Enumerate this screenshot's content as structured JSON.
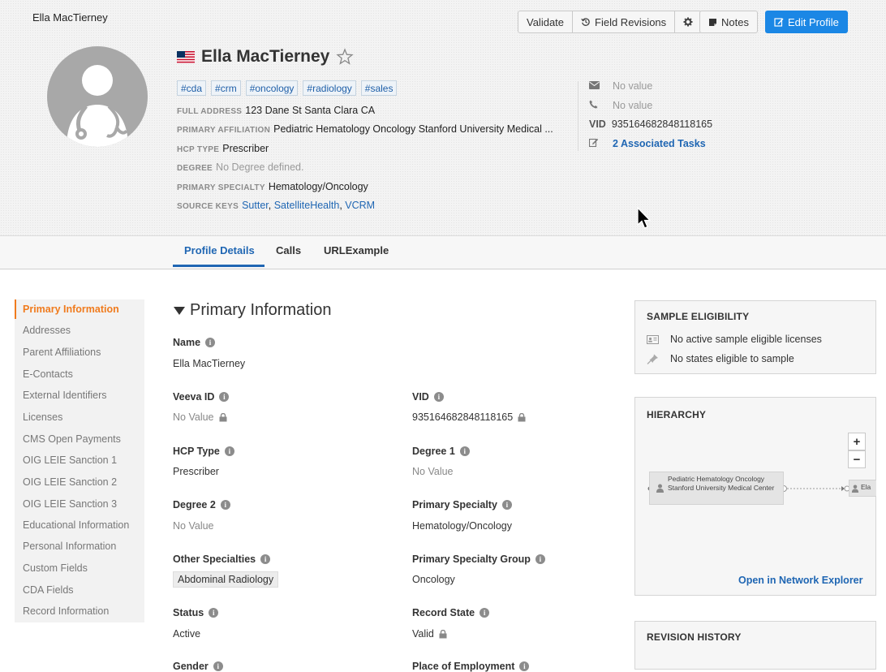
{
  "window": {
    "title": "Ella MacTierney"
  },
  "toolbar": {
    "validate_label": "Validate",
    "field_revisions_label": "Field Revisions",
    "notes_label": "Notes",
    "edit_profile_label": "Edit Profile",
    "accent_color": "#1b87e5"
  },
  "profile": {
    "name": "Ella MacTierney",
    "tags": [
      "#cda",
      "#crm",
      "#oncology",
      "#radiology",
      "#sales"
    ],
    "full_address_label": "FULL ADDRESS",
    "full_address": "123 Dane St Santa Clara CA",
    "primary_affiliation_label": "PRIMARY AFFILIATION",
    "primary_affiliation": "Pediatric Hematology Oncology Stanford University Medical ...",
    "hcp_type_label": "HCP TYPE",
    "hcp_type": "Prescriber",
    "degree_label": "DEGREE",
    "degree": "No Degree defined.",
    "primary_specialty_label": "PRIMARY SPECIALTY",
    "primary_specialty": "Hematology/Oncology",
    "source_keys_label": "SOURCE KEYS",
    "source_keys": [
      "Sutter",
      "SatelliteHealth",
      "VCRM"
    ],
    "source_keys_sep": ", "
  },
  "contact": {
    "email": "No value",
    "phone": "No value",
    "vid_label": "VID",
    "vid": "935164682848118165",
    "tasks": "2 Associated Tasks"
  },
  "tabs": [
    "Profile Details",
    "Calls",
    "URLExample"
  ],
  "nav": {
    "items": [
      "Primary Information",
      "Addresses",
      "Parent Affiliations",
      "E-Contacts",
      "External Identifiers",
      "Licenses",
      "CMS Open Payments",
      "OIG LEIE Sanction 1",
      "OIG LEIE Sanction 2",
      "OIG LEIE Sanction 3",
      "Educational Information",
      "Personal Information",
      "Custom Fields",
      "CDA Fields",
      "Record Information"
    ],
    "active_color": "#f07b1d"
  },
  "primary_info": {
    "title": "Primary Information",
    "name_label": "Name",
    "name_value": "Ella MacTierney",
    "veeva_id_label": "Veeva ID",
    "veeva_id_value": "No Value",
    "vid_label": "VID",
    "vid_value": "935164682848118165",
    "hcp_type_label": "HCP Type",
    "hcp_type_value": "Prescriber",
    "degree1_label": "Degree 1",
    "degree1_value": "No Value",
    "degree2_label": "Degree 2",
    "degree2_value": "No Value",
    "primary_specialty_label": "Primary Specialty",
    "primary_specialty_value": "Hematology/Oncology",
    "other_specialties_label": "Other Specialties",
    "other_specialties_value": "Abdominal Radiology",
    "psg_label": "Primary Specialty Group",
    "psg_value": "Oncology",
    "status_label": "Status",
    "status_value": "Active",
    "record_state_label": "Record State",
    "record_state_value": "Valid",
    "gender_label": "Gender",
    "place_of_employment_label": "Place of Employment"
  },
  "sample_eligibility": {
    "title": "SAMPLE ELIGIBILITY",
    "licenses": "No active sample eligible licenses",
    "states": "No states eligible to sample"
  },
  "hierarchy": {
    "title": "HIERARCHY",
    "zoom_in": "+",
    "zoom_out": "−",
    "parent_node": "Pediatric Hematology Oncology Stanford University Medical Center",
    "child_node": "Ela",
    "explorer_link": "Open in Network Explorer"
  },
  "revision_history": {
    "title": "REVISION HISTORY"
  }
}
